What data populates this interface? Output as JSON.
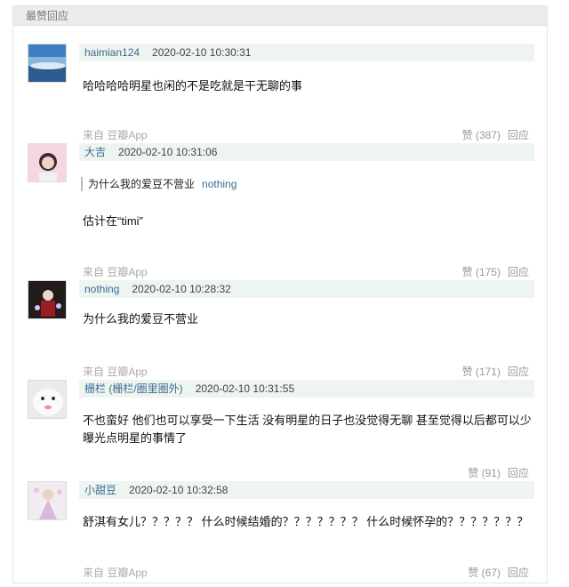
{
  "section_title": "最赞回应",
  "comments": [
    {
      "author": "haimian124",
      "author_extra": "",
      "time": "2020-02-10 10:30:31",
      "quote": null,
      "text": "哈哈哈哈明星也闲的不是吃就是干无聊的事",
      "source": "来自 豆瓣App",
      "likes": "赞 (387)",
      "reply": "回应",
      "avatar": "sky-sea-avatar"
    },
    {
      "author": "大吉",
      "author_extra": "",
      "time": "2020-02-10 10:31:06",
      "quote": {
        "text": "为什么我的爱豆不营业",
        "user": "nothing"
      },
      "text": "估计在“timi”",
      "source": "来自 豆瓣App",
      "likes": "赞 (175)",
      "reply": "回应",
      "avatar": "girl-pink-avatar"
    },
    {
      "author": "nothing",
      "author_extra": "",
      "time": "2020-02-10 10:28:32",
      "quote": null,
      "text": "为什么我的爱豆不营业",
      "source": "来自 豆瓣App",
      "likes": "赞 (171)",
      "reply": "回应",
      "avatar": "dark-figure-avatar"
    },
    {
      "author": "栅栏",
      "author_extra": " (栅栏/圈里圈外)",
      "time": "2020-02-10 10:31:55",
      "quote": null,
      "text": "不也蛮好 他们也可以享受一下生活 没有明星的日子也没觉得无聊 甚至觉得以后都可以少曝光点明星的事情了",
      "source": "",
      "likes": "赞 (91)",
      "reply": "回应",
      "avatar": "white-fluffy-avatar"
    },
    {
      "author": "小甜豆",
      "author_extra": "",
      "time": "2020-02-10 10:32:58",
      "quote": null,
      "text": "舒淇有女儿？？？？？ 什么时候结婚的？？？？？？？ 什么时候怀孕的？？？？？？？",
      "source": "来自 豆瓣App",
      "likes": "赞 (67)",
      "reply": "回应",
      "avatar": "doll-dress-avatar"
    }
  ]
}
